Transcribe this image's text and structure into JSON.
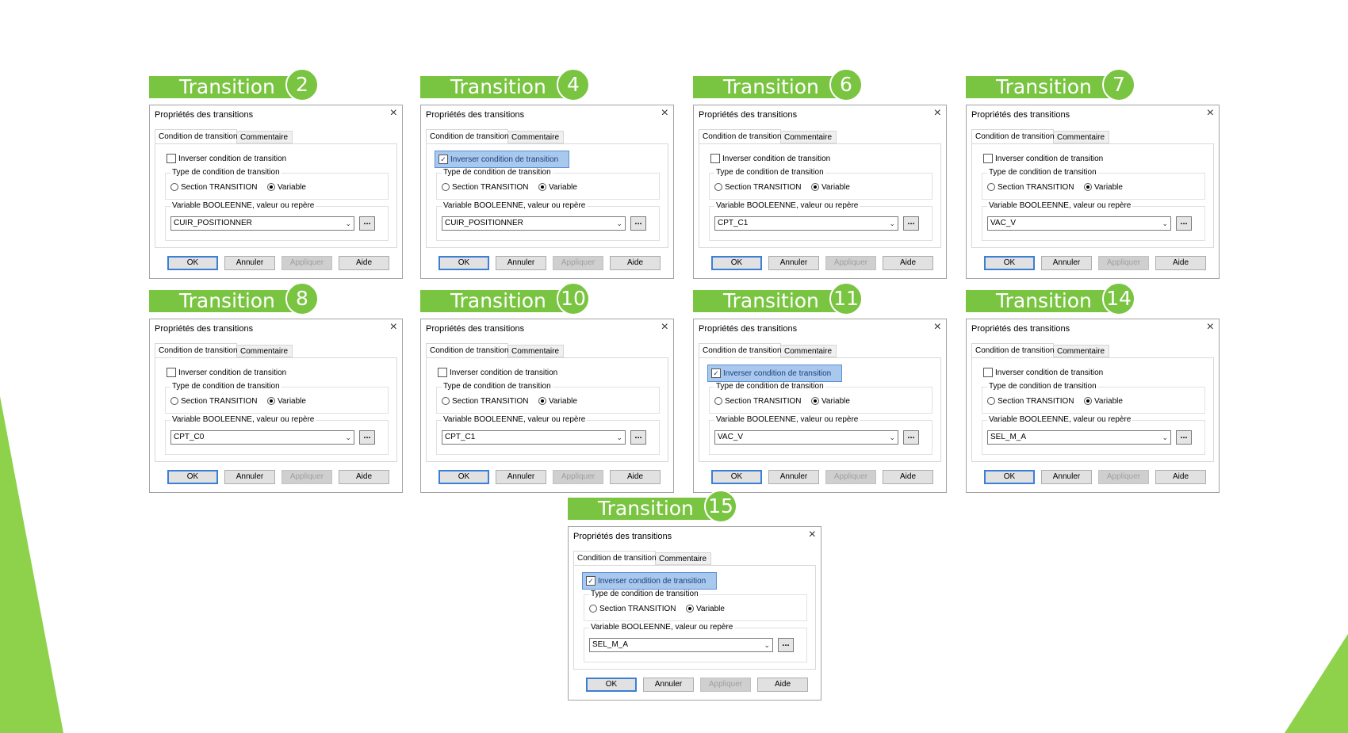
{
  "colors": {
    "accent": "#79c440",
    "highlight": "#a9c8ee"
  },
  "dialog_title": "Propriétés des transitions",
  "tab_condition": "Condition de transition",
  "tab_comment": "Commentaire",
  "invert_label": "Inverser condition de transition",
  "type_label": "Type de condition de transition",
  "opt_section": "Section TRANSITION",
  "opt_variable": "Variable",
  "var_label": "Variable BOOLEENNE, valeur ou repère",
  "btn_ok": "OK",
  "btn_annuler": "Annuler",
  "btn_appliquer": "Appliquer",
  "btn_aide": "Aide",
  "browse_label": "...",
  "close_icon": "×",
  "dropdown_icon": "⌄",
  "panels": [
    {
      "title": "Transition",
      "number": "2",
      "variable": "CUIR_POSITIONNER",
      "inverted": false
    },
    {
      "title": "Transition",
      "number": "4",
      "variable": "CUIR_POSITIONNER",
      "inverted": true
    },
    {
      "title": "Transition",
      "number": "6",
      "variable": "CPT_C1",
      "inverted": false
    },
    {
      "title": "Transition",
      "number": "7",
      "variable": "VAC_V",
      "inverted": false
    },
    {
      "title": "Transition",
      "number": "8",
      "variable": "CPT_C0",
      "inverted": false
    },
    {
      "title": "Transition",
      "number": "10",
      "variable": "CPT_C1",
      "inverted": false
    },
    {
      "title": "Transition",
      "number": "11",
      "variable": "VAC_V",
      "inverted": true
    },
    {
      "title": "Transition",
      "number": "14",
      "variable": "SEL_M_A",
      "inverted": false
    },
    {
      "title": "Transition",
      "number": "15",
      "variable": "SEL_M_A",
      "inverted": true
    }
  ]
}
